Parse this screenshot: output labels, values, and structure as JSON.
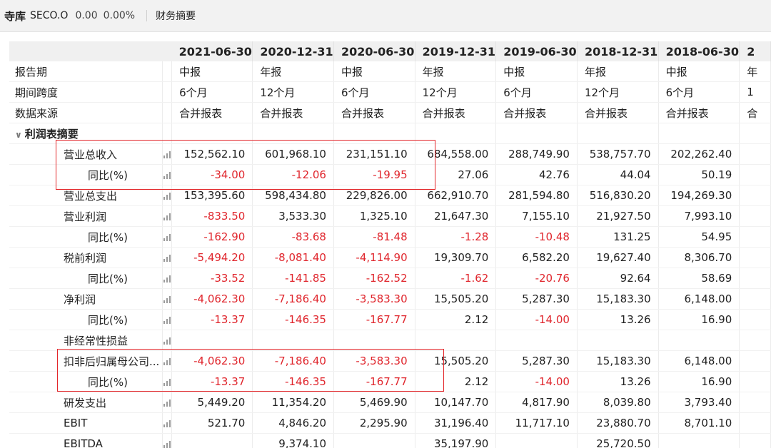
{
  "header": {
    "name": "寺库",
    "code": "SECO.O",
    "price": "0.00",
    "change": "0.00%",
    "tab": "财务摘要"
  },
  "columns": [
    "2021-06-30",
    "2020-12-31",
    "2020-06-30",
    "2019-12-31",
    "2019-06-30",
    "2018-12-31",
    "2018-06-30",
    "2"
  ],
  "meta_rows": [
    {
      "label": "报告期",
      "values": [
        "中报",
        "年报",
        "中报",
        "年报",
        "中报",
        "年报",
        "中报",
        "年"
      ]
    },
    {
      "label": "期间跨度",
      "values": [
        "6个月",
        "12个月",
        "6个月",
        "12个月",
        "6个月",
        "12个月",
        "6个月",
        "1"
      ]
    },
    {
      "label": "数据来源",
      "values": [
        "合并报表",
        "合并报表",
        "合并报表",
        "合并报表",
        "合并报表",
        "合并报表",
        "合并报表",
        "合"
      ]
    }
  ],
  "section": {
    "label": "利润表摘要"
  },
  "rows": [
    {
      "label": "营业总收入",
      "indent": 1,
      "values": [
        "152,562.10",
        "601,968.10",
        "231,151.10",
        "684,558.00",
        "288,749.90",
        "538,757.70",
        "202,262.40"
      ],
      "red": [
        false,
        false,
        false,
        false,
        false,
        false,
        false
      ]
    },
    {
      "label": "同比(%)",
      "indent": 2,
      "values": [
        "-34.00",
        "-12.06",
        "-19.95",
        "27.06",
        "42.76",
        "44.04",
        "50.19"
      ],
      "red": [
        true,
        true,
        true,
        false,
        false,
        false,
        false
      ]
    },
    {
      "label": "营业总支出",
      "indent": 1,
      "values": [
        "153,395.60",
        "598,434.80",
        "229,826.00",
        "662,910.70",
        "281,594.80",
        "516,830.20",
        "194,269.30"
      ],
      "red": [
        false,
        false,
        false,
        false,
        false,
        false,
        false
      ]
    },
    {
      "label": "营业利润",
      "indent": 1,
      "values": [
        "-833.50",
        "3,533.30",
        "1,325.10",
        "21,647.30",
        "7,155.10",
        "21,927.50",
        "7,993.10"
      ],
      "red": [
        true,
        false,
        false,
        false,
        false,
        false,
        false
      ]
    },
    {
      "label": "同比(%)",
      "indent": 2,
      "values": [
        "-162.90",
        "-83.68",
        "-81.48",
        "-1.28",
        "-10.48",
        "131.25",
        "54.95"
      ],
      "red": [
        true,
        true,
        true,
        true,
        true,
        false,
        false
      ]
    },
    {
      "label": "税前利润",
      "indent": 1,
      "values": [
        "-5,494.20",
        "-8,081.40",
        "-4,114.90",
        "19,309.70",
        "6,582.20",
        "19,627.40",
        "8,306.70"
      ],
      "red": [
        true,
        true,
        true,
        false,
        false,
        false,
        false
      ]
    },
    {
      "label": "同比(%)",
      "indent": 2,
      "values": [
        "-33.52",
        "-141.85",
        "-162.52",
        "-1.62",
        "-20.76",
        "92.64",
        "58.69"
      ],
      "red": [
        true,
        true,
        true,
        true,
        true,
        false,
        false
      ]
    },
    {
      "label": "净利润",
      "indent": 1,
      "values": [
        "-4,062.30",
        "-7,186.40",
        "-3,583.30",
        "15,505.20",
        "5,287.30",
        "15,183.30",
        "6,148.00"
      ],
      "red": [
        true,
        true,
        true,
        false,
        false,
        false,
        false
      ]
    },
    {
      "label": "同比(%)",
      "indent": 2,
      "values": [
        "-13.37",
        "-146.35",
        "-167.77",
        "2.12",
        "-14.00",
        "13.26",
        "16.90"
      ],
      "red": [
        true,
        true,
        true,
        false,
        true,
        false,
        false
      ]
    },
    {
      "label": "非经常性损益",
      "indent": 1,
      "values": [
        "",
        "",
        "",
        "",
        "",
        "",
        ""
      ],
      "red": [
        false,
        false,
        false,
        false,
        false,
        false,
        false
      ]
    },
    {
      "label": "扣非后归属母公司...",
      "indent": 1,
      "values": [
        "-4,062.30",
        "-7,186.40",
        "-3,583.30",
        "15,505.20",
        "5,287.30",
        "15,183.30",
        "6,148.00"
      ],
      "red": [
        true,
        true,
        true,
        false,
        false,
        false,
        false
      ]
    },
    {
      "label": "同比(%)",
      "indent": 2,
      "values": [
        "-13.37",
        "-146.35",
        "-167.77",
        "2.12",
        "-14.00",
        "13.26",
        "16.90"
      ],
      "red": [
        true,
        true,
        true,
        false,
        true,
        false,
        false
      ]
    },
    {
      "label": "研发支出",
      "indent": 1,
      "values": [
        "5,449.20",
        "11,354.20",
        "5,469.90",
        "10,147.70",
        "4,817.90",
        "8,039.80",
        "3,793.40"
      ],
      "red": [
        false,
        false,
        false,
        false,
        false,
        false,
        false
      ]
    },
    {
      "label": "EBIT",
      "indent": 1,
      "values": [
        "521.70",
        "4,846.20",
        "2,295.90",
        "31,196.40",
        "11,717.10",
        "23,880.70",
        "8,701.10"
      ],
      "red": [
        false,
        false,
        false,
        false,
        false,
        false,
        false
      ]
    },
    {
      "label": "EBITDA",
      "indent": 1,
      "values": [
        "",
        "9,374.10",
        "",
        "35,197.90",
        "",
        "25,720.50",
        ""
      ],
      "red": [
        false,
        false,
        false,
        false,
        false,
        false,
        false
      ]
    }
  ]
}
